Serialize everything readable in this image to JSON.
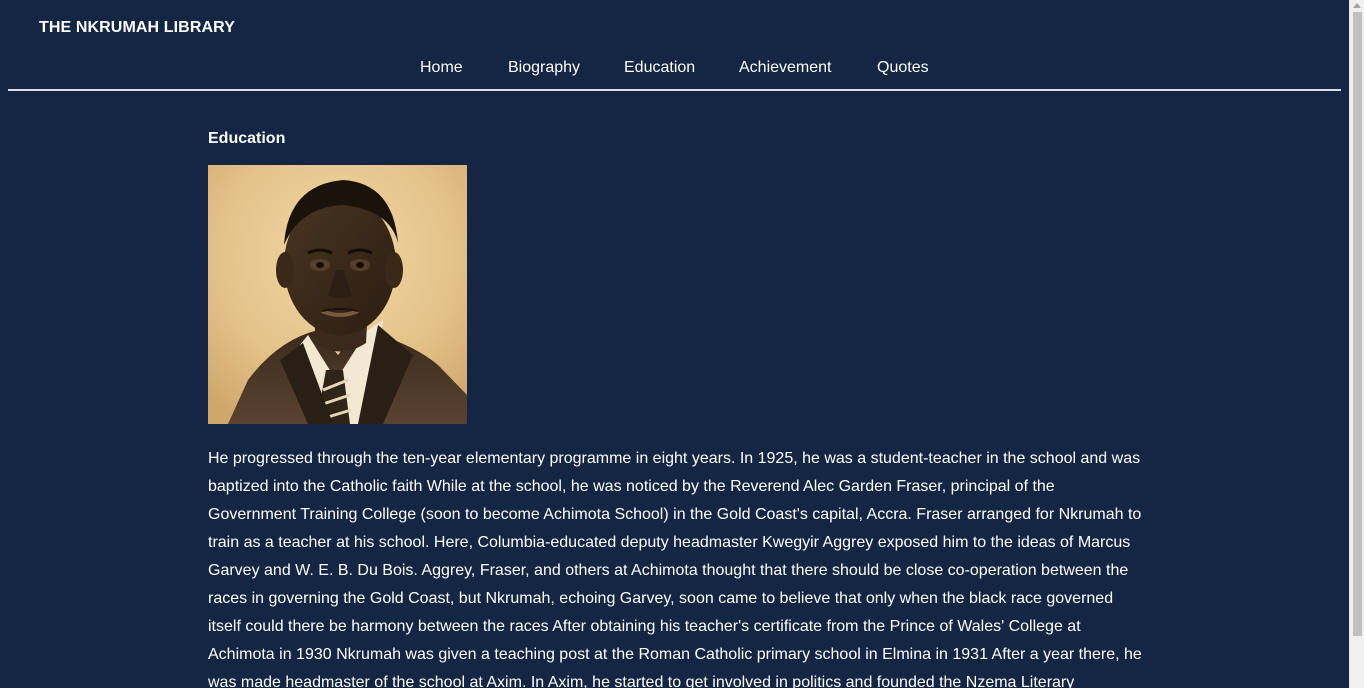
{
  "site": {
    "title": "THE NKRUMAH LIBRARY"
  },
  "nav": {
    "items": [
      {
        "label": "Home"
      },
      {
        "label": "Biography"
      },
      {
        "label": "Education"
      },
      {
        "label": "Achievement"
      },
      {
        "label": "Quotes"
      }
    ]
  },
  "main": {
    "heading": "Education",
    "portrait_alt": "Portrait of Kwame Nkrumah",
    "paragraph": "He progressed through the ten-year elementary programme in eight years. In 1925, he was a student-teacher in the school and was baptized into the Catholic faith While at the school, he was noticed by the Reverend Alec Garden Fraser, principal of the Government Training College (soon to become Achimota School) in the Gold Coast's capital, Accra. Fraser arranged for Nkrumah to train as a teacher at his school. Here, Columbia-educated deputy headmaster Kwegyir Aggrey exposed him to the ideas of Marcus Garvey and W. E. B. Du Bois. Aggrey, Fraser, and others at Achimota thought that there should be close co-operation between the races in governing the Gold Coast, but Nkrumah, echoing Garvey, soon came to believe that only when the black race governed itself could there be harmony between the races After obtaining his teacher's certificate from the Prince of Wales' College at Achimota in 1930 Nkrumah was given a teaching post at the Roman Catholic primary school in Elmina in 1931 After a year there, he was made headmaster of the school at Axim. In Axim, he started to get involved in politics and founded the Nzema Literary"
  },
  "colors": {
    "background": "#142643",
    "text": "#ffffff",
    "rule": "#d9dde3",
    "sepia_light": "#e9c98f",
    "sepia_dark": "#2c2116"
  }
}
